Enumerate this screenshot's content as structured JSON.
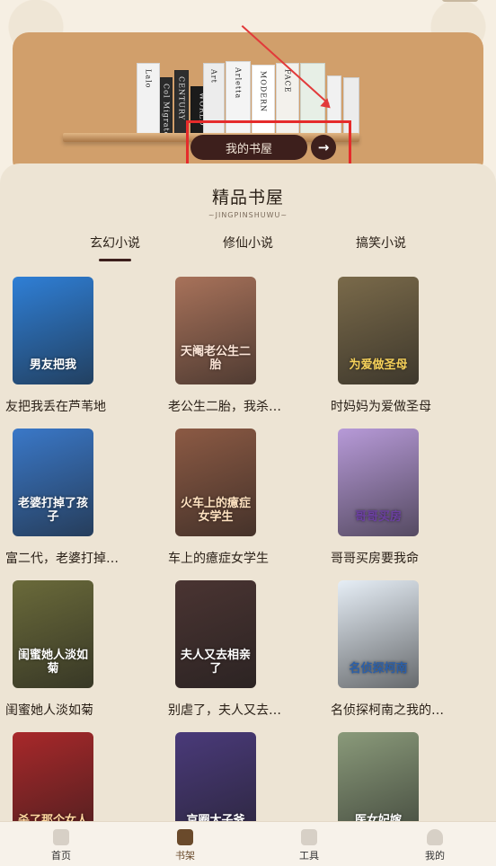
{
  "banner": {
    "shelf_button_label": "我的书屋",
    "arrow_glyph": "→",
    "spines": [
      "Lalo",
      "Col Migrate",
      "CENTURY",
      "WORLD",
      "Art",
      "Arletta",
      "MODERN",
      "FACE"
    ]
  },
  "section": {
    "title": "精品书屋",
    "subtitle": "~JINGPINSHUWU~"
  },
  "tabs": [
    {
      "label": "玄幻小说",
      "active": true
    },
    {
      "label": "修仙小说",
      "active": false
    },
    {
      "label": "搞笑小说",
      "active": false
    }
  ],
  "books": [
    {
      "title": "友把我丢在芦苇地",
      "cover_text": "男友把我",
      "bg": "#2f7fd6",
      "fg": "#ffffff"
    },
    {
      "title": "老公生二胎，我杀…",
      "cover_text": "天阉老公生二胎",
      "bg": "#a8725a",
      "fg": "#fde6d8"
    },
    {
      "title": "时妈妈为爱做圣母",
      "cover_text": "为爱做圣母",
      "bg": "#7a6a4a",
      "fg": "#f7d25a"
    },
    {
      "title": "富二代，老婆打掉…",
      "cover_text": "老婆打掉了孩子",
      "bg": "#3a78c8",
      "fg": "#ffffff"
    },
    {
      "title": "车上的癔症女学生",
      "cover_text": "火车上的癔症女学生",
      "bg": "#8c5a44",
      "fg": "#ffe2c0"
    },
    {
      "title": "哥哥买房要我命",
      "cover_text": "哥哥买房",
      "bg": "#b79ad8",
      "fg": "#6b3fa0"
    },
    {
      "title": "闺蜜她人淡如菊",
      "cover_text": "闺蜜她人淡如菊",
      "bg": "#6a6a3a",
      "fg": "#ffffff"
    },
    {
      "title": "别虐了，夫人又去…",
      "cover_text": "夫人又去相亲了",
      "bg": "#4a3432",
      "fg": "#ffffff"
    },
    {
      "title": "名侦探柯南之我的…",
      "cover_text": "名侦探柯南",
      "bg": "#e6eef6",
      "fg": "#2b5fa8"
    },
    {
      "title": "",
      "cover_text": "杀了那个女人",
      "bg": "#a8282a",
      "fg": "#ffd8a0"
    },
    {
      "title": "",
      "cover_text": "京圈太子爷",
      "bg": "#4a3a7a",
      "fg": "#ffffff"
    },
    {
      "title": "",
      "cover_text": "医女妃嫁",
      "bg": "#8a9a7a",
      "fg": "#ffffff"
    }
  ],
  "nav": [
    {
      "label": "首页",
      "icon": "home-icon",
      "active": false
    },
    {
      "label": "书架",
      "icon": "bookshelf-icon",
      "active": true
    },
    {
      "label": "工具",
      "icon": "toolbox-icon",
      "active": false
    },
    {
      "label": "我的",
      "icon": "user-icon",
      "active": false
    }
  ]
}
